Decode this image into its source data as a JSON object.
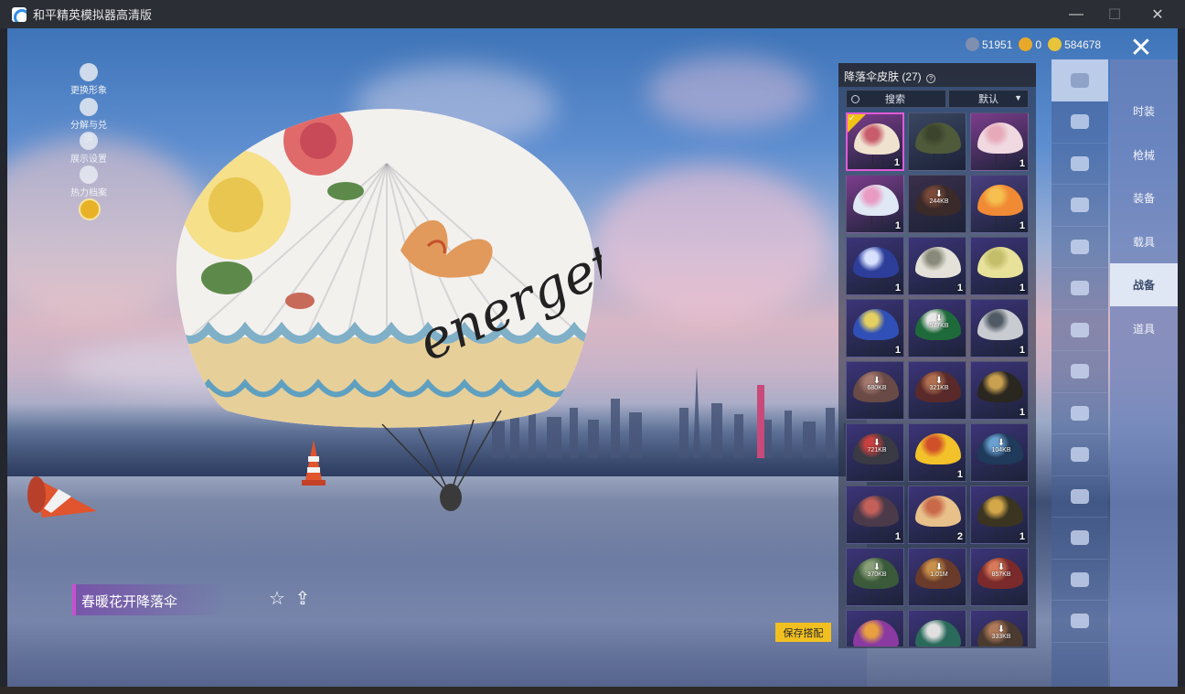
{
  "window": {
    "title": "和平精英模拟器高清版",
    "minimize": "—",
    "maximize": "☐",
    "close": "✕"
  },
  "side_tools": [
    "更换形象",
    "分解与兑换",
    "展示设置",
    "热力档案"
  ],
  "currency": [
    {
      "value": "51951",
      "color": "#7f8fb0"
    },
    {
      "value": "0",
      "color": "#e8a92a"
    },
    {
      "value": "584678",
      "color": "#e8c43a"
    }
  ],
  "exit_label": "✕",
  "panel": {
    "title": "降落伞皮肤 (27)",
    "help": "?",
    "search_label": "搜索",
    "sort_label": "默认",
    "sort_chevron": "▼"
  },
  "items": [
    {
      "count": "1",
      "size": "",
      "color": "#efe3d0",
      "accent": "#c85c6c",
      "bg": "#7c3d8c",
      "equipped": true
    },
    {
      "count": "",
      "size": "",
      "color": "#4f5a3a",
      "accent": "#3c452c",
      "bg": "#3a4660",
      "equipped": false
    },
    {
      "count": "1",
      "size": "",
      "color": "#f0d9e0",
      "accent": "#e7a9b9",
      "bg": "#7c3d8c",
      "equipped": false
    },
    {
      "count": "1",
      "size": "",
      "color": "#dfe8f4",
      "accent": "#e99bc4",
      "bg": "#7c3d8c",
      "equipped": false
    },
    {
      "count": "",
      "size": "244KB",
      "color": "#3a2a2a",
      "accent": "#7a4a3a",
      "bg": "#3a2f4a",
      "equipped": false
    },
    {
      "count": "1",
      "size": "",
      "color": "#f08a34",
      "accent": "#f5c050",
      "bg": "#4a3f80",
      "equipped": false
    },
    {
      "count": "1",
      "size": "",
      "color": "#2c3e9a",
      "accent": "#d8e0ff",
      "bg": "#3c3478",
      "equipped": false
    },
    {
      "count": "1",
      "size": "",
      "color": "#e4e2d8",
      "accent": "#8a8a7a",
      "bg": "#3c3478",
      "equipped": false
    },
    {
      "count": "1",
      "size": "",
      "color": "#e7e19a",
      "accent": "#c4bd6a",
      "bg": "#3c3478",
      "equipped": false
    },
    {
      "count": "1",
      "size": "",
      "color": "#3050b8",
      "accent": "#e4d060",
      "bg": "#3c3478",
      "equipped": false
    },
    {
      "count": "",
      "size": "577KB",
      "color": "#1f6a3a",
      "accent": "#e8e8e8",
      "bg": "#3c3478",
      "equipped": false
    },
    {
      "count": "1",
      "size": "",
      "color": "#c8ccd0",
      "accent": "#505a64",
      "bg": "#3c3478",
      "equipped": false
    },
    {
      "count": "",
      "size": "680KB",
      "color": "#6a4a46",
      "accent": "#a47a70",
      "bg": "#3c3478",
      "equipped": false
    },
    {
      "count": "",
      "size": "321KB",
      "color": "#5a2a2a",
      "accent": "#b07050",
      "bg": "#3c3478",
      "equipped": false
    },
    {
      "count": "1",
      "size": "",
      "color": "#2a2620",
      "accent": "#c8a050",
      "bg": "#3c3478",
      "equipped": false
    },
    {
      "count": "",
      "size": "721KB",
      "color": "#3a3a44",
      "accent": "#c84040",
      "bg": "#3c3478",
      "equipped": false
    },
    {
      "count": "1",
      "size": "",
      "color": "#f3c22a",
      "accent": "#d0502a",
      "bg": "#3c3478",
      "equipped": false
    },
    {
      "count": "",
      "size": "104KB",
      "color": "#1f3a5a",
      "accent": "#6aa0d0",
      "bg": "#3c3478",
      "equipped": false
    },
    {
      "count": "1",
      "size": "",
      "color": "#4a3a4a",
      "accent": "#c4605a",
      "bg": "#3c3478",
      "equipped": false
    },
    {
      "count": "2",
      "size": "",
      "color": "#e8c08a",
      "accent": "#c86a4a",
      "bg": "#3c3478",
      "equipped": false
    },
    {
      "count": "1",
      "size": "",
      "color": "#3a3420",
      "accent": "#d4a84a",
      "bg": "#3c3478",
      "equipped": false
    },
    {
      "count": "",
      "size": "370KB",
      "color": "#3a5a3a",
      "accent": "#8aa07a",
      "bg": "#3c3478",
      "equipped": false
    },
    {
      "count": "",
      "size": "1.01M",
      "color": "#6a3a2a",
      "accent": "#c8904a",
      "bg": "#3c3478",
      "equipped": false
    },
    {
      "count": "",
      "size": "857KB",
      "color": "#7a2a2a",
      "accent": "#d87a5a",
      "bg": "#3c3478",
      "equipped": false
    },
    {
      "count": "",
      "size": "",
      "color": "#8a3aa0",
      "accent": "#e8a040",
      "bg": "#3c3478",
      "equipped": false
    },
    {
      "count": "",
      "size": "",
      "color": "#2a6a5a",
      "accent": "#e0e0e0",
      "bg": "#3c3478",
      "equipped": false
    },
    {
      "count": "",
      "size": "333KB",
      "color": "#4a3a30",
      "accent": "#b07a5a",
      "bg": "#3c3478",
      "equipped": false
    }
  ],
  "category_icons": [
    "parachute-icon",
    "glider-icon",
    "drone-icon",
    "plane-icon",
    "emote-icon",
    "plane-trail-icon",
    "badge-icon",
    "voice-icon",
    "speech-bubble-icon",
    "photo-icon",
    "fire-extinguisher-icon",
    "hand-icon",
    "sparkle-icon",
    "frog-icon"
  ],
  "tabs": [
    "时装",
    "枪械",
    "装备",
    "载具",
    "战备",
    "道具"
  ],
  "active_tab_index": 4,
  "item_name": "春暖花开降落伞",
  "save_label": "保存搭配",
  "favorite_icon": "☆",
  "share_icon": "⇪",
  "parachute_text": "energetic"
}
